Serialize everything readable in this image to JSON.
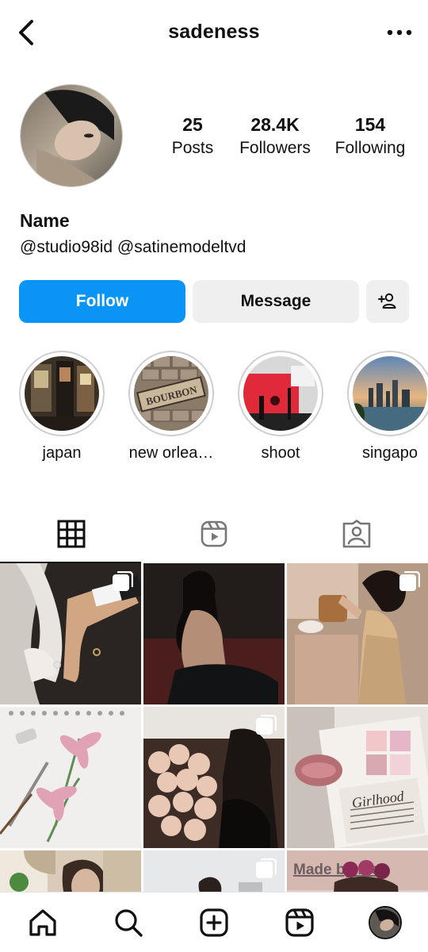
{
  "header": {
    "username": "sadeness",
    "back_icon": "chevron-left-icon",
    "more_icon": "more-horizontal-icon"
  },
  "profile": {
    "stats": {
      "posts_count": "25",
      "posts_label": "Posts",
      "followers_count": "28.4K",
      "followers_label": "Followers",
      "following_count": "154",
      "following_label": "Following"
    },
    "name": "Name",
    "handles": "@studio98id @satinemodeltvd"
  },
  "actions": {
    "follow_label": "Follow",
    "message_label": "Message",
    "add_user_icon": "add-user-icon",
    "follow_color": "#0a95f6"
  },
  "highlights": [
    {
      "label": "japan"
    },
    {
      "label": "new orlea…"
    },
    {
      "label": "shoot"
    },
    {
      "label": "singapo"
    }
  ],
  "tabs": [
    {
      "icon": "grid-icon",
      "active": true
    },
    {
      "icon": "reels-icon",
      "active": false
    },
    {
      "icon": "tagged-icon",
      "active": false
    }
  ],
  "grid_posts": [
    {
      "multi": true
    },
    {
      "multi": false
    },
    {
      "multi": true
    },
    {
      "multi": false
    },
    {
      "multi": true
    },
    {
      "multi": false
    },
    {
      "multi": false
    },
    {
      "multi": true
    },
    {
      "multi": false
    }
  ],
  "post_overlay_text": {
    "girlhood": "Girlhood",
    "made_by": "Made by me"
  },
  "bottom_nav": [
    {
      "icon": "home-icon"
    },
    {
      "icon": "search-icon"
    },
    {
      "icon": "create-icon"
    },
    {
      "icon": "reels-icon"
    },
    {
      "icon": "profile-avatar"
    }
  ]
}
